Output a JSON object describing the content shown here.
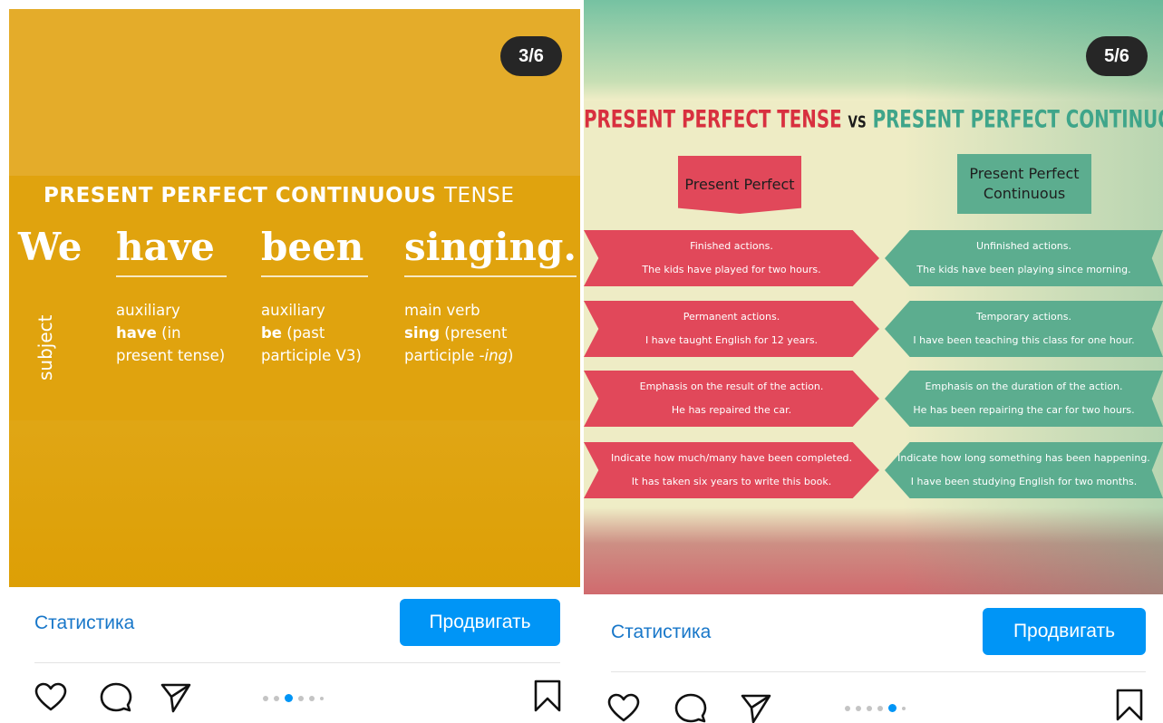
{
  "posts": [
    {
      "counter": "3/6",
      "slide": {
        "heading_bold": "PRESENT PERFECT CONTINUOUS",
        "heading_light": "TENSE",
        "words": [
          "We",
          "have",
          "been",
          "singing."
        ],
        "subject_label": "subject",
        "roles": [
          {
            "line1": "auxiliary",
            "bold": "have",
            "rest": " (in",
            "line3": "present tense)"
          },
          {
            "line1": "auxiliary",
            "bold": "be",
            "rest": " (past",
            "line3": "participle V3)"
          },
          {
            "line1": "main verb",
            "bold": "sing",
            "rest": " (present",
            "line3_pre": "participle ",
            "line3_italic": "-ing",
            "line3_post": ")"
          }
        ]
      },
      "stats_label": "Статистика",
      "promote_label": "Продвигать",
      "carousel": {
        "total": 6,
        "active_index": 2
      }
    },
    {
      "counter": "5/6",
      "slide": {
        "title_red": "PRESENT PERFECT TENSE",
        "title_vs": "VS",
        "title_green": "PRESENT PERFECT CONTINUOUS TENSE",
        "left_header": "Present Perfect",
        "right_header_line1": "Present Perfect",
        "right_header_line2": "Continuous",
        "rows": [
          {
            "left_title": "Finished actions.",
            "left_example": "The kids have played for two hours.",
            "right_title": "Unfinished actions.",
            "right_example": "The kids have been playing since morning."
          },
          {
            "left_title": "Permanent actions.",
            "left_example": "I have taught English for 12 years.",
            "right_title": "Temporary actions.",
            "right_example": "I have been teaching this class for one hour."
          },
          {
            "left_title": "Emphasis on the result of the action.",
            "left_example": "He has repaired the car.",
            "right_title": "Emphasis on the duration of the action.",
            "right_example": "He has been repairing the car for two hours."
          },
          {
            "left_title": "Indicate how much/many have been completed.",
            "left_example": "It has taken six years to write this book.",
            "right_title": "Indicate how long something has been happening.",
            "right_example": "I have been studying English for two months."
          }
        ]
      },
      "stats_label": "Статистика",
      "promote_label": "Продвигать",
      "carousel": {
        "total": 6,
        "active_index": 4
      }
    }
  ],
  "icons": {
    "like": "heart-icon",
    "comment": "comment-icon",
    "share": "send-icon",
    "save": "bookmark-icon"
  },
  "colors": {
    "accent": "#0095f6",
    "link": "#1877c9",
    "slide_yellow": "#e0a30e",
    "ribbon_red": "#e1485a",
    "ribbon_green": "#5cad8f"
  }
}
